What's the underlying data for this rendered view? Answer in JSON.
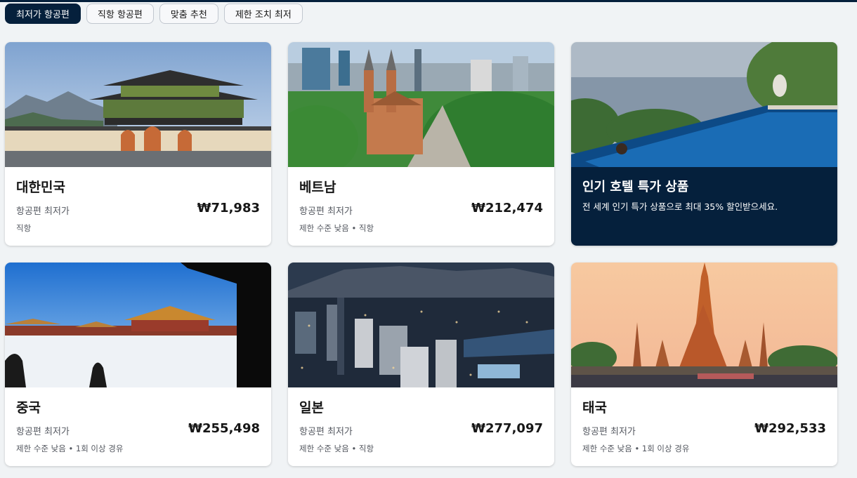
{
  "tabs": [
    {
      "label": "최저가 항공편",
      "active": true
    },
    {
      "label": "직항 항공편",
      "active": false
    },
    {
      "label": "맞춤 추천",
      "active": false
    },
    {
      "label": "제한 조치 최저",
      "active": false
    }
  ],
  "cards": [
    {
      "name": "대한민국",
      "fare_label": "항공편 최저가",
      "price": "₩71,983",
      "detail": "직항",
      "image": "gyeongbokgung-palace-image"
    },
    {
      "name": "베트남",
      "fare_label": "항공편 최저가",
      "price": "₩212,474",
      "detail": "제한 수준 낮음 • 직항",
      "image": "saigon-cathedral-image"
    },
    {
      "name": "중국",
      "fare_label": "항공편 최저가",
      "price": "₩255,498",
      "detail": "제한 수준 낮음 • 1회 이상 경유",
      "image": "forbidden-city-snow-image"
    },
    {
      "name": "일본",
      "fare_label": "항공편 최저가",
      "price": "₩277,097",
      "detail": "제한 수준 낮음 • 직항",
      "image": "tokyo-city-night-image"
    },
    {
      "name": "태국",
      "fare_label": "항공편 최저가",
      "price": "₩292,533",
      "detail": "제한 수준 낮음 • 1회 이상 경유",
      "image": "wat-arun-temple-image"
    }
  ],
  "promo": {
    "title": "인기 호텔 특가 상품",
    "description": "전 세계 인기 특가 상품으로 최대 35% 할인받으세요.",
    "image": "infinity-pool-image"
  },
  "colors": {
    "brand_navy": "#05203c",
    "page_bg": "#f0f3f5"
  }
}
